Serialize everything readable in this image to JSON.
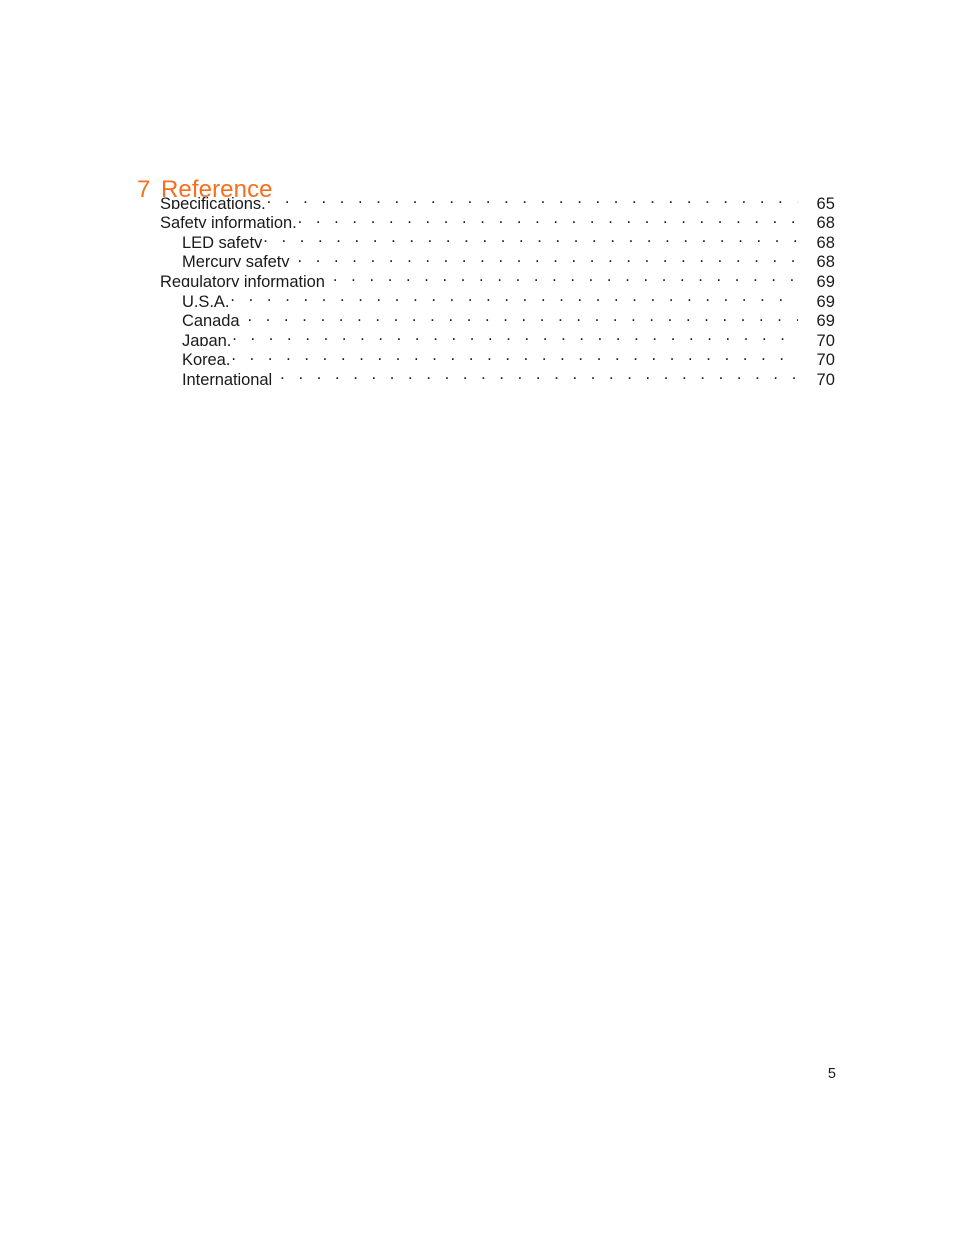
{
  "document": {
    "type": "table-of-contents-page",
    "background_color": "#ffffff",
    "text_color": "#1a1a1a"
  },
  "heading": {
    "number": "7",
    "title": "Reference",
    "color": "#f5701e"
  },
  "toc": {
    "entries": [
      {
        "label": "Specifications.",
        "page": "65",
        "level": 1,
        "spacer": false
      },
      {
        "label": "Safety information.",
        "page": "68",
        "level": 1,
        "spacer": false
      },
      {
        "label": "LED safety",
        "page": "68",
        "level": 2,
        "spacer": false
      },
      {
        "label": "Mercury safety",
        "page": "68",
        "level": 2,
        "spacer": true
      },
      {
        "label": "Regulatory information",
        "page": "69",
        "level": 1,
        "spacer": true
      },
      {
        "label": "U.S.A.",
        "page": "69",
        "level": 2,
        "spacer": false
      },
      {
        "label": "Canada",
        "page": "69",
        "level": 2,
        "spacer": true
      },
      {
        "label": "Japan.",
        "page": "70",
        "level": 2,
        "spacer": false
      },
      {
        "label": "Korea.",
        "page": "70",
        "level": 2,
        "spacer": false
      },
      {
        "label": "International",
        "page": "70",
        "level": 2,
        "spacer": true
      }
    ]
  },
  "footer": {
    "page_number": "5"
  }
}
